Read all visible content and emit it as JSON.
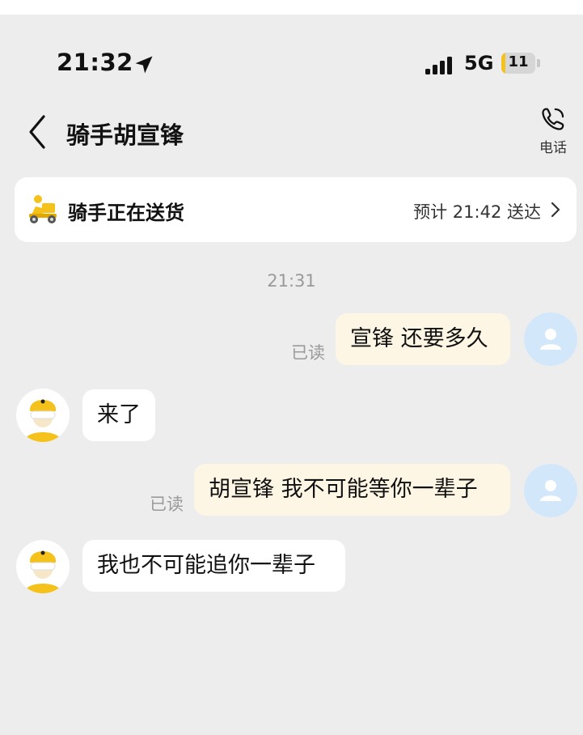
{
  "status_bar": {
    "time": "21:32",
    "location_icon": "location-arrow-icon",
    "signal_icon": "cellular-signal-icon",
    "network": "5G",
    "battery_level": "11",
    "battery_fraction": 0.11
  },
  "nav": {
    "back_icon": "chevron-left-icon",
    "title": "骑手胡宣锋",
    "call_icon": "phone-icon",
    "call_label": "电话"
  },
  "delivery_card": {
    "icon": "delivery-scooter-icon",
    "status": "骑手正在送货",
    "eta": "预计 21:42 送达",
    "chevron_icon": "chevron-right-icon"
  },
  "timestamp": "21:31",
  "messages": [
    {
      "sender": "me",
      "text": "宣锋 还要多久",
      "read": "已读"
    },
    {
      "sender": "rider",
      "text": "来了"
    },
    {
      "sender": "me",
      "text": "胡宣锋 我不可能等你一辈子",
      "read": "已读"
    },
    {
      "sender": "rider",
      "text": "我也不可能追你一辈子"
    }
  ],
  "colors": {
    "background": "#ededed",
    "my_bubble": "#fdf6e4",
    "rider_bubble": "#ffffff",
    "my_avatar": "#d3e7fb",
    "accent_yellow": "#f4c21a",
    "muted_text": "#9a9a9a"
  }
}
